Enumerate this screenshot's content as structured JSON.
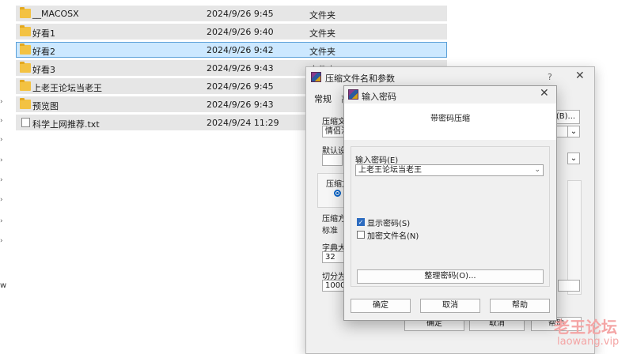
{
  "explorer": {
    "rows": [
      {
        "name": "__MACOSX",
        "date": "2024/9/26 9:45",
        "type": "文件夹",
        "icon": "folder-icon"
      },
      {
        "name": "好看1",
        "date": "2024/9/26 9:40",
        "type": "文件夹",
        "icon": "folder-icon"
      },
      {
        "name": "好看2",
        "date": "2024/9/26 9:42",
        "type": "文件夹",
        "icon": "folder-icon"
      },
      {
        "name": "好看3",
        "date": "2024/9/26 9:43",
        "type": "文件夹",
        "icon": "folder-icon"
      },
      {
        "name": "上老王论坛当老王",
        "date": "2024/9/26 9:45",
        "type": "",
        "icon": "folder-icon"
      },
      {
        "name": "预览图",
        "date": "2024/9/26 9:43",
        "type": "",
        "icon": "folder-icon"
      },
      {
        "name": "科学上网推荐.txt",
        "date": "2024/9/24 11:29",
        "type": "",
        "icon": "text-file-icon"
      }
    ],
    "sidebar_fragment": "w"
  },
  "archive_dialog": {
    "title": "压缩文件名和参数",
    "help": "?",
    "close": "✕",
    "tab_general": "常规",
    "tab_advanced": "高",
    "archive_name_label": "压缩文件",
    "archive_name_value": "情侣泄",
    "browse_button": "(B)...",
    "default_settings_label": "默认设置",
    "format_label": "压缩文",
    "method_label": "压缩方",
    "method_value": "标准",
    "dict_label": "字典大小",
    "dict_value": "32",
    "split_label": "切分为分",
    "split_value": "1000",
    "ok_button": "确定",
    "cancel_button": "取消",
    "help_button": "帮助"
  },
  "password_dialog": {
    "title": "输入密码",
    "close": "✕",
    "banner": "带密码压缩",
    "enter_label": "输入密码(E)",
    "password_value": "上老王论坛当老王",
    "show_password_label": "显示密码(S)",
    "show_password_checked": true,
    "encrypt_names_label": "加密文件名(N)",
    "encrypt_names_checked": false,
    "organize_button": "整理密码(O)...",
    "ok_button": "确定",
    "cancel_button": "取消",
    "help_button": "帮助"
  },
  "watermark": {
    "line1": "老王论坛",
    "line2": "laowang.vip"
  }
}
